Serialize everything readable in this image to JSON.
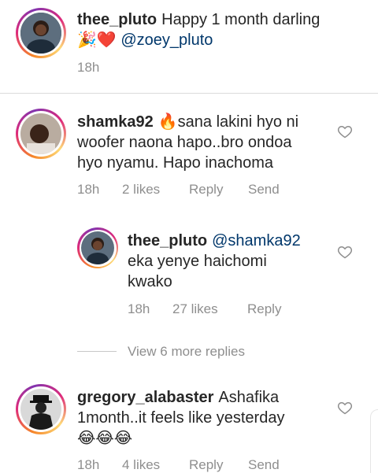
{
  "caption": {
    "username": "thee_pluto",
    "text": "Happy 1 month darling",
    "emoji": "🎉❤️",
    "mention": "@zoey_pluto",
    "time": "18h"
  },
  "comments": [
    {
      "username": "shamka92",
      "text_line1": "🔥sana lakini hyo ni",
      "text_line2": "woofer naona hapo..bro ondoa",
      "text_line3": "hyo nyamu. Hapo inachoma",
      "time": "18h",
      "likes": "2 likes",
      "reply": "Reply",
      "send": "Send"
    },
    {
      "username": "gregory_alabaster",
      "text_line1": "Ashafika",
      "text_line2": "1month..it feels like yesterday",
      "text_line3": "😂😂😂",
      "time": "18h",
      "likes": "4 likes",
      "reply": "Reply",
      "send": "Send"
    }
  ],
  "reply": {
    "username": "thee_pluto",
    "mention": "@shamka92",
    "text_line1": "eka yenye haichomi",
    "text_line2": "kwako",
    "time": "18h",
    "likes": "27 likes",
    "reply": "Reply"
  },
  "view_more": "View 6 more replies",
  "colors": {
    "link": "#00376b",
    "meta": "#8e8e8e",
    "text": "#262626"
  }
}
